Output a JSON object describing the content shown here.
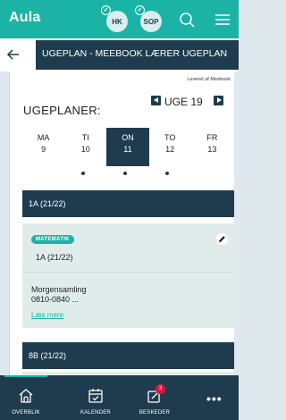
{
  "app": {
    "name": "Aula"
  },
  "header": {
    "avatars": [
      {
        "initials": "HK"
      },
      {
        "initials": "SOP"
      }
    ],
    "checkmark": "✓",
    "icons": [
      "search-icon",
      "menu-icon"
    ]
  },
  "titlebar": {
    "title": "UGEPLAN - MEEBOOK LÆRER UGEPLAN",
    "back_icon": "arrow-left-icon"
  },
  "content": {
    "provider": "Leveret af Meebook",
    "section_title": "UGEPLANER:",
    "week": {
      "label": "UGE 19"
    },
    "days": [
      {
        "name": "MA",
        "date": "9"
      },
      {
        "name": "TI",
        "date": "10"
      },
      {
        "name": "ON",
        "date": "11",
        "selected": true
      },
      {
        "name": "TO",
        "date": "12"
      },
      {
        "name": "FR",
        "date": "13"
      }
    ],
    "groups": [
      {
        "name": "1A (21/22)",
        "card": {
          "subject": "MATEMATIK",
          "class": "1A (21/22)",
          "title_line1": "Morgensamling",
          "title_line2": "0810-0840 ...",
          "read_more": "Læs mere"
        }
      },
      {
        "name": "8B (21/22)"
      }
    ]
  },
  "bottom_nav": {
    "items": [
      {
        "label": "OVERBLIK",
        "icon": "home-icon",
        "active": true
      },
      {
        "label": "KALENDER",
        "icon": "calendar-icon"
      },
      {
        "label": "BESKEDER",
        "icon": "messages-icon",
        "badge": "3"
      },
      {
        "label": "",
        "icon": "more-icon"
      }
    ],
    "more": "•••"
  },
  "colors": {
    "teal": "#1bb3a6",
    "navy": "#1f3c4e",
    "badge_red": "#d6173a"
  }
}
